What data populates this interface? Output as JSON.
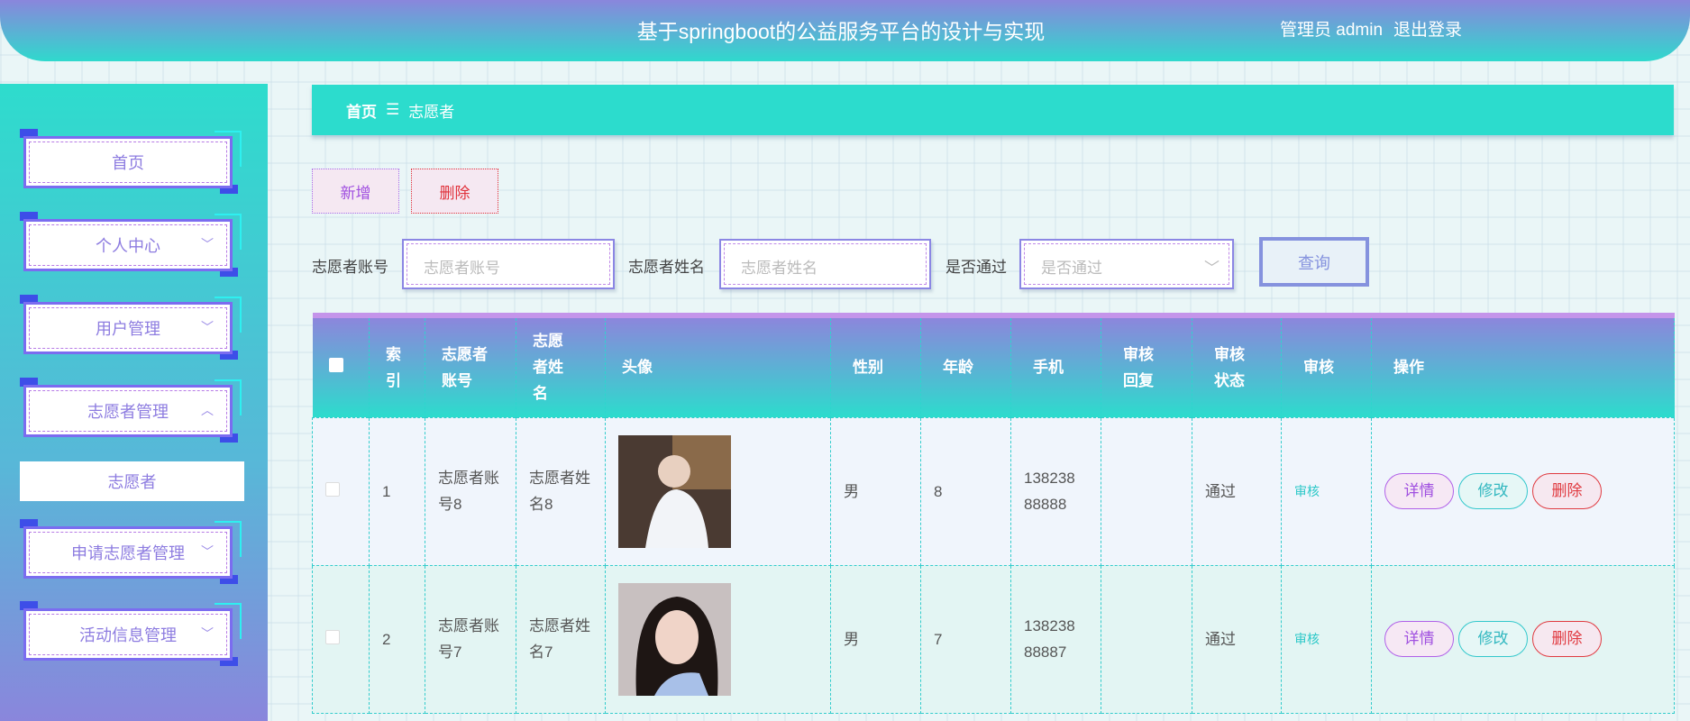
{
  "header": {
    "title": "基于springboot的公益服务平台的设计与实现",
    "user_role": "管理员 admin",
    "logout": "退出登录"
  },
  "sidebar": {
    "items": [
      {
        "label": "首页"
      },
      {
        "label": "个人中心"
      },
      {
        "label": "用户管理"
      },
      {
        "label": "志愿者管理"
      },
      {
        "label": "申请志愿者管理"
      },
      {
        "label": "活动信息管理"
      }
    ],
    "sub_item": "志愿者"
  },
  "breadcrumb": {
    "home": "首页",
    "sep": "☰",
    "current": "志愿者"
  },
  "toolbar": {
    "add": "新增",
    "delete": "删除"
  },
  "search": {
    "account_label": "志愿者账号",
    "account_placeholder": "志愿者账号",
    "name_label": "志愿者姓名",
    "name_placeholder": "志愿者姓名",
    "pass_label": "是否通过",
    "pass_placeholder": "是否通过",
    "query": "查询"
  },
  "table": {
    "headers": [
      "",
      "索引",
      "志愿者账号",
      "志愿者姓名",
      "头像",
      "性别",
      "年龄",
      "手机",
      "审核回复",
      "审核状态",
      "审核",
      "操作"
    ],
    "rows": [
      {
        "index": "1",
        "account": "志愿者账号8",
        "name": "志愿者姓名8",
        "gender": "男",
        "age": "8",
        "phone": "13823888888",
        "reply": "",
        "status": "通过",
        "audit": "审核"
      },
      {
        "index": "2",
        "account": "志愿者账号7",
        "name": "志愿者姓名7",
        "gender": "男",
        "age": "7",
        "phone": "13823888887",
        "reply": "",
        "status": "通过",
        "audit": "审核"
      }
    ],
    "actions": {
      "detail": "详情",
      "edit": "修改",
      "delete": "删除"
    }
  },
  "colors": {
    "accent": "#2cdccd",
    "purple": "#8a86dc"
  }
}
